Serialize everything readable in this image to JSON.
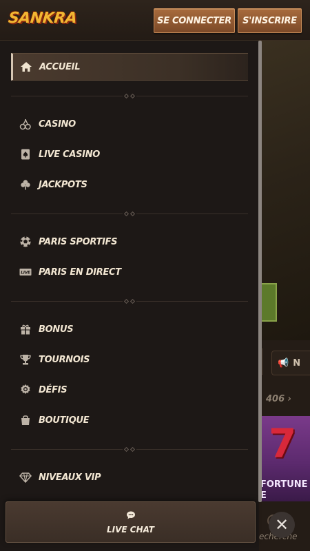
{
  "header": {
    "logo_text": "SANKRA",
    "login_label": "SE CONNECTER",
    "signup_label": "S'INSCRIRE"
  },
  "menu": {
    "groups": [
      {
        "items": [
          {
            "label": "ACCUEIL",
            "icon": "home-icon",
            "active": true
          }
        ]
      },
      {
        "items": [
          {
            "label": "CASINO",
            "icon": "cherries-icon"
          },
          {
            "label": "LIVE CASINO",
            "icon": "card-spade-icon"
          },
          {
            "label": "JACKPOTS",
            "icon": "clover-icon"
          }
        ]
      },
      {
        "items": [
          {
            "label": "PARIS SPORTIFS",
            "icon": "soccer-ball-icon"
          },
          {
            "label": "PARIS EN DIRECT",
            "icon": "live-badge-icon",
            "badge": "LIVE"
          }
        ]
      },
      {
        "items": [
          {
            "label": "BONUS",
            "icon": "gift-icon"
          },
          {
            "label": "TOURNOIS",
            "icon": "trophy-icon"
          },
          {
            "label": "DÉFIS",
            "icon": "medal-icon"
          },
          {
            "label": "BOUTIQUE",
            "icon": "shopping-bag-icon"
          }
        ]
      },
      {
        "items": [
          {
            "label": "NIVEAUX VIP",
            "icon": "diamond-icon"
          }
        ]
      }
    ]
  },
  "live_chat": {
    "label": "LIVE CHAT",
    "icon": "chat-bubble-icon"
  },
  "close": {
    "icon": "close-icon",
    "glyph": "✕"
  },
  "background_page": {
    "count": "406",
    "news_label": "N",
    "game_title_line1": "FORTUNE",
    "game_title_line2": "E DOUBLE",
    "seven_glyph": "7",
    "search_label": "echerche"
  },
  "colors": {
    "accent_button": "#a86b3d",
    "menu_bg": "#1d1816",
    "text": "#f2e6d2"
  }
}
